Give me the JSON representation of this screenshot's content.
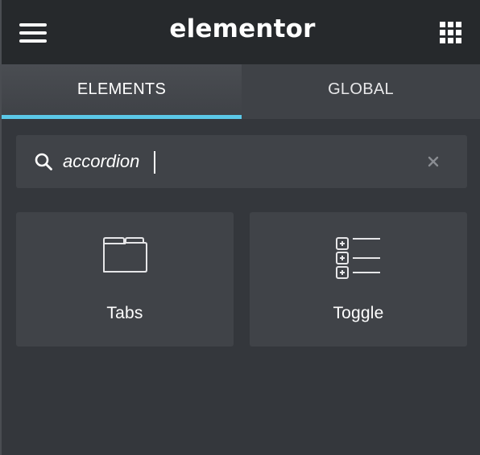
{
  "header": {
    "brand": "elementor",
    "menu_icon": "hamburger-menu-icon",
    "apps_icon": "grid-apps-icon"
  },
  "tabs": [
    {
      "label": "ELEMENTS",
      "active": true
    },
    {
      "label": "GLOBAL",
      "active": false
    }
  ],
  "search": {
    "value": "accordion",
    "icon": "search-icon",
    "clear_icon": "close-icon"
  },
  "widgets": [
    {
      "label": "Tabs",
      "icon": "tabs-icon"
    },
    {
      "label": "Toggle",
      "icon": "toggle-list-icon"
    }
  ],
  "colors": {
    "header_bg": "#26292c",
    "panel_bg": "#34373c",
    "card_bg": "#404348",
    "active_tab_indicator": "#5bc8e8",
    "text": "#ffffff"
  }
}
